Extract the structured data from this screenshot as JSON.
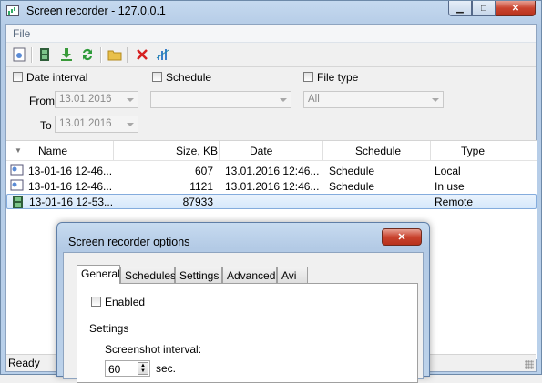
{
  "window": {
    "title": "Screen recorder - 127.0.0.1"
  },
  "menu": {
    "file": "File"
  },
  "filters": {
    "date_interval_label": "Date interval",
    "schedule_label": "Schedule",
    "file_type_label": "File type",
    "from_label": "From",
    "to_label": "To",
    "from_value": "13.01.2016",
    "to_value": "13.01.2016",
    "schedule_value": "",
    "file_type_value": "All"
  },
  "grid": {
    "columns": [
      "Name",
      "Size, KB",
      "Date",
      "Schedule",
      "Type"
    ],
    "rows": [
      {
        "name": "13-01-16 12-46...",
        "size": "607",
        "date": "13.01.2016 12:46...",
        "schedule": "Schedule",
        "type": "Local"
      },
      {
        "name": "13-01-16 12-46...",
        "size": "1121",
        "date": "13.01.2016 12:46...",
        "schedule": "Schedule",
        "type": "In use"
      },
      {
        "name": "13-01-16 12-53...",
        "size": "87933",
        "date": "",
        "schedule": "",
        "type": "Remote"
      }
    ]
  },
  "status": {
    "text": "Ready"
  },
  "dialog": {
    "title": "Screen recorder options",
    "tabs": [
      "General",
      "Schedules",
      "Settings",
      "Advanced",
      "Avi"
    ],
    "enabled_label": "Enabled",
    "settings_header": "Settings",
    "interval_label": "Screenshot interval:",
    "interval_value": "60",
    "interval_unit": "sec."
  },
  "icons": {
    "toolbar": [
      "options-icon",
      "film-icon",
      "download-icon",
      "refresh-icon",
      "folder-icon",
      "delete-icon",
      "chart-icon"
    ]
  },
  "colors": {
    "accent": "#3399ff",
    "close": "#c9432e"
  }
}
